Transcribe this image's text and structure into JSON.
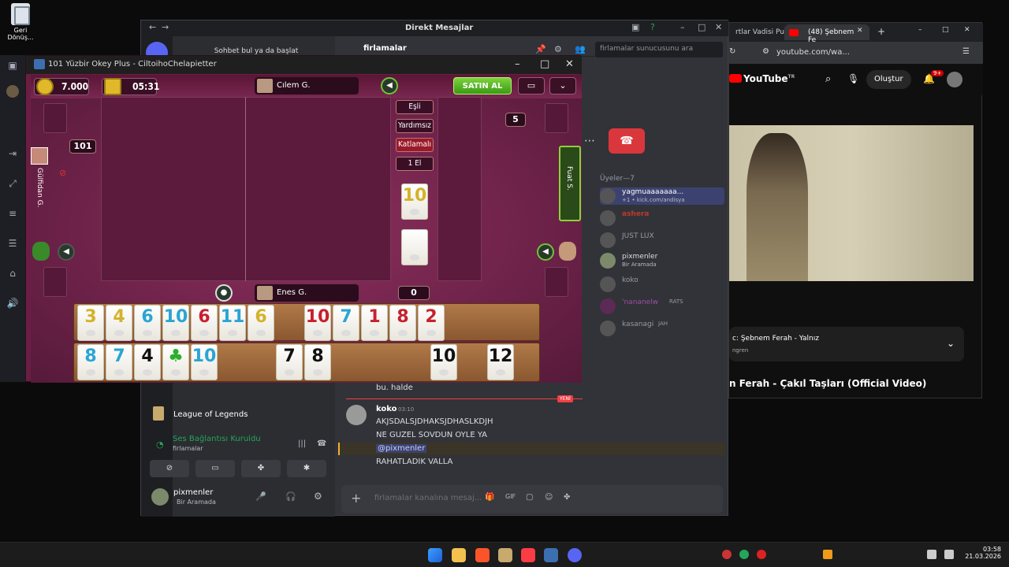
{
  "desktop": {
    "recycle_bin_label": "Geri Dönüş..."
  },
  "discord": {
    "window_title": "Direkt Mesajlar",
    "dm_search": "Sohbet bul ya da başlat",
    "channel_name": "firlamalar",
    "server_search_placeholder": "firlamalar sunucusunu ara",
    "members_header": "Üyeler—7",
    "members": [
      {
        "name": "yagmuaaaaaaa...",
        "status": "+1 • kick.com/andisya"
      },
      {
        "name": "ashera",
        "status": ""
      },
      {
        "name": "JUST LUX",
        "status": ""
      },
      {
        "name": "pixmenler",
        "status": "Bir Aramada"
      },
      {
        "name": "koko",
        "status": ""
      },
      {
        "name": "'nananelw",
        "status": "RATS"
      },
      {
        "name": "kasanagi",
        "status": "JAH"
      }
    ],
    "server_title": "League of Legends",
    "voice_status": "Ses Bağlantısı Kuruldu",
    "voice_channel": "firlamalar",
    "user_name": "pixmenler",
    "user_status": "Bir Aramada",
    "prev_line": "bu. halde",
    "new_tag": "YENİ",
    "message": {
      "author": "koko",
      "time": "03:10",
      "lines": [
        "AKJSDALSJDHAKSJDHASLKDJH",
        "NE GUZEL SOVDUN OYLE YA",
        "@pixmenler",
        "RAHATLADIK VALLA"
      ]
    },
    "composer_placeholder": "firlamalar kanalına mesaj..."
  },
  "game": {
    "window_title": "101 Yüzbir Okey Plus - CiltoihoChelapietter",
    "coins": "7.000",
    "timer": "05:31",
    "buy_label": "SATIN AL",
    "player_top": "Cılem G.",
    "player_left": "Gülfidan G.",
    "player_right": "Fuat S.",
    "player_bottom": "Enes G.",
    "left_count": "101",
    "right_count": "5",
    "bottom_count": "0",
    "options": [
      "Eşli",
      "Yardımsız",
      "Katlamalı",
      "1 El"
    ],
    "indicator_tile": "10",
    "rack_top": [
      {
        "v": "3",
        "c": "y"
      },
      {
        "v": "4",
        "c": "y"
      },
      {
        "v": "6",
        "c": "b"
      },
      {
        "v": "10",
        "c": "b"
      },
      {
        "v": "6",
        "c": "r"
      },
      {
        "v": "11",
        "c": "b"
      },
      {
        "v": "6",
        "c": "y"
      },
      {
        "v": "10",
        "c": "r"
      },
      {
        "v": "7",
        "c": "b"
      },
      {
        "v": "1",
        "c": "r"
      },
      {
        "v": "8",
        "c": "r"
      },
      {
        "v": "2",
        "c": "r"
      }
    ],
    "rack_bottom": [
      {
        "v": "8",
        "c": "b"
      },
      {
        "v": "7",
        "c": "b"
      },
      {
        "v": "4",
        "c": "k"
      },
      {
        "v": "♣",
        "c": "g"
      },
      {
        "v": "10",
        "c": "b"
      },
      {
        "v": "7",
        "c": "k"
      },
      {
        "v": "8",
        "c": "k"
      },
      {
        "v": "10",
        "c": "k"
      },
      {
        "v": "12",
        "c": "k"
      }
    ]
  },
  "youtube": {
    "tab_left": "rtlar Vadisi Pus",
    "tab_active": "(48) Şebnem Fe",
    "url": "youtube.com/wa...",
    "logo": "YouTube",
    "logo_sup": "TR",
    "create_label": "Oluştur",
    "notif_count": "9+",
    "now_playing": "c: Şebnem Ferah - Yalnız",
    "now_playing_sub": "ngren",
    "video_title": "n Ferah - Çakıl Taşları (Official Video)"
  },
  "taskbar": {
    "time": "03:58",
    "date": "21.03.2026"
  }
}
